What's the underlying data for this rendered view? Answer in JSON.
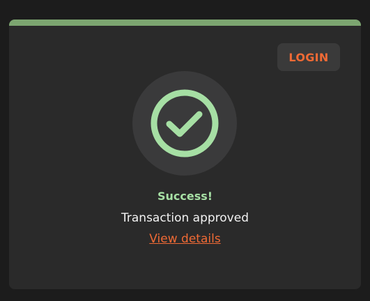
{
  "card": {
    "accent_color": "#7ca570",
    "background_color": "#2a2a2a"
  },
  "header": {
    "login_label": "LOGIN",
    "login_color": "#f06a35"
  },
  "status": {
    "icon": "check-circle-icon",
    "icon_color": "#a6dfa4",
    "title": "Success!",
    "message": "Transaction approved",
    "link_label": "View details"
  }
}
